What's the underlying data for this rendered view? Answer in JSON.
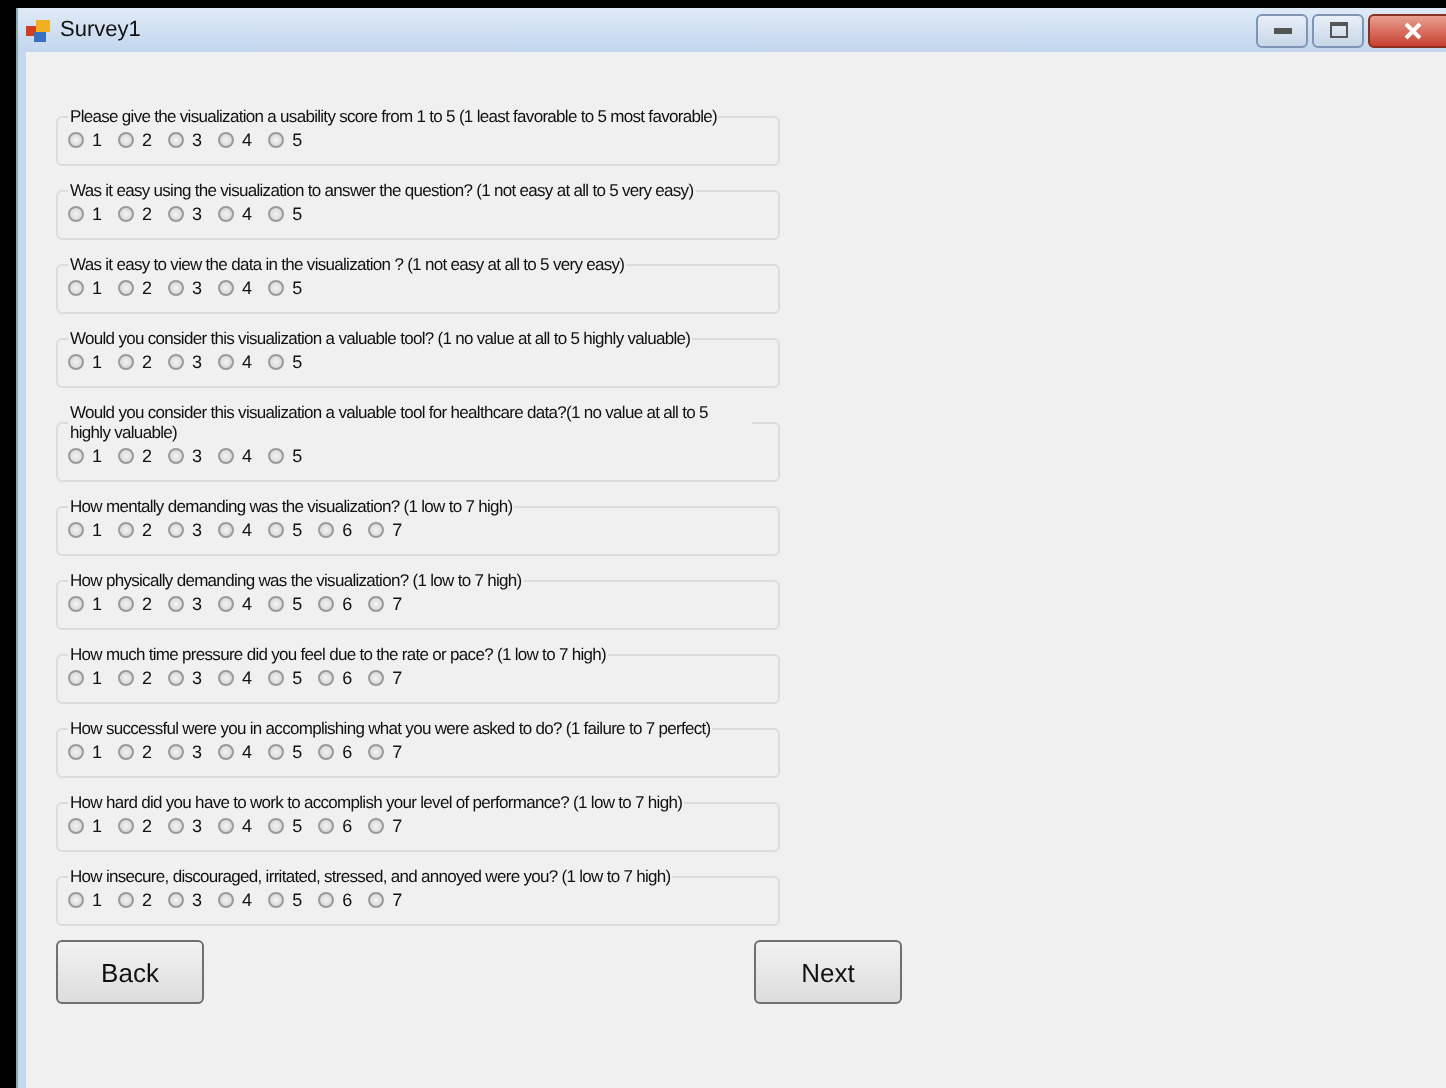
{
  "window": {
    "title": "Survey1"
  },
  "questions": [
    {
      "text": "Please give the visualization a usability score from 1 to 5 (1 least favorable to 5 most favorable)",
      "options": [
        {
          "label": "1",
          "selected": false
        },
        {
          "label": "2",
          "selected": false
        },
        {
          "label": "3",
          "selected": false
        },
        {
          "label": "4",
          "selected": false
        },
        {
          "label": "5",
          "selected": false
        }
      ]
    },
    {
      "text": "Was it easy using the visualization to answer the question? (1 not easy at all to 5 very easy)",
      "options": [
        {
          "label": "1",
          "selected": false
        },
        {
          "label": "2",
          "selected": false
        },
        {
          "label": "3",
          "selected": false
        },
        {
          "label": "4",
          "selected": false
        },
        {
          "label": "5",
          "selected": false
        }
      ]
    },
    {
      "text": "Was it easy to view the data in the visualization ? (1 not easy at all to 5 very easy)",
      "options": [
        {
          "label": "1",
          "selected": false
        },
        {
          "label": "2",
          "selected": false
        },
        {
          "label": "3",
          "selected": false
        },
        {
          "label": "4",
          "selected": false
        },
        {
          "label": "5",
          "selected": false
        }
      ]
    },
    {
      "text": "Would you consider this visualization a valuable tool? (1 no value at all to 5 highly valuable)",
      "options": [
        {
          "label": "1",
          "selected": false
        },
        {
          "label": "2",
          "selected": false
        },
        {
          "label": "3",
          "selected": false
        },
        {
          "label": "4",
          "selected": false
        },
        {
          "label": "5",
          "selected": false
        }
      ]
    },
    {
      "text": "Would you consider this visualization a valuable tool for healthcare data?(1 no value at all to 5 highly valuable)",
      "options": [
        {
          "label": "1",
          "selected": false
        },
        {
          "label": "2",
          "selected": false
        },
        {
          "label": "3",
          "selected": false
        },
        {
          "label": "4",
          "selected": false
        },
        {
          "label": "5",
          "selected": false
        }
      ]
    },
    {
      "text": "How mentally demanding was the visualization? (1 low to 7 high)",
      "options": [
        {
          "label": "1",
          "selected": false
        },
        {
          "label": "2",
          "selected": false
        },
        {
          "label": "3",
          "selected": false
        },
        {
          "label": "4",
          "selected": false
        },
        {
          "label": "5",
          "selected": false
        },
        {
          "label": "6",
          "selected": false
        },
        {
          "label": "7",
          "selected": false
        }
      ]
    },
    {
      "text": "How physically demanding was the visualization? (1 low to 7 high)",
      "options": [
        {
          "label": "1",
          "selected": false
        },
        {
          "label": "2",
          "selected": false
        },
        {
          "label": "3",
          "selected": false
        },
        {
          "label": "4",
          "selected": false
        },
        {
          "label": "5",
          "selected": false
        },
        {
          "label": "6",
          "selected": false
        },
        {
          "label": "7",
          "selected": false
        }
      ]
    },
    {
      "text": "How much time pressure did you feel due to the rate or pace? (1 low to 7 high)",
      "options": [
        {
          "label": "1",
          "selected": false
        },
        {
          "label": "2",
          "selected": false
        },
        {
          "label": "3",
          "selected": false
        },
        {
          "label": "4",
          "selected": false
        },
        {
          "label": "5",
          "selected": false
        },
        {
          "label": "6",
          "selected": false
        },
        {
          "label": "7",
          "selected": false
        }
      ]
    },
    {
      "text": "How successful were you in accomplishing what you were asked to do? (1 failure to 7 perfect)",
      "options": [
        {
          "label": "1",
          "selected": false
        },
        {
          "label": "2",
          "selected": false
        },
        {
          "label": "3",
          "selected": false
        },
        {
          "label": "4",
          "selected": false
        },
        {
          "label": "5",
          "selected": false
        },
        {
          "label": "6",
          "selected": false
        },
        {
          "label": "7",
          "selected": false
        }
      ]
    },
    {
      "text": "How hard did you have to work to accomplish your level of performance? (1 low to 7 high)",
      "options": [
        {
          "label": "1",
          "selected": false
        },
        {
          "label": "2",
          "selected": false
        },
        {
          "label": "3",
          "selected": false
        },
        {
          "label": "4",
          "selected": false
        },
        {
          "label": "5",
          "selected": false
        },
        {
          "label": "6",
          "selected": false
        },
        {
          "label": "7",
          "selected": false
        }
      ]
    },
    {
      "text": "How insecure, discouraged, irritated, stressed, and annoyed were you? (1 low to 7 high)",
      "options": [
        {
          "label": "1",
          "selected": false
        },
        {
          "label": "2",
          "selected": false
        },
        {
          "label": "3",
          "selected": false
        },
        {
          "label": "4",
          "selected": false
        },
        {
          "label": "5",
          "selected": false
        },
        {
          "label": "6",
          "selected": false
        },
        {
          "label": "7",
          "selected": false
        }
      ]
    }
  ],
  "buttons": [
    {
      "label": "Back"
    },
    {
      "label": "Next"
    }
  ]
}
